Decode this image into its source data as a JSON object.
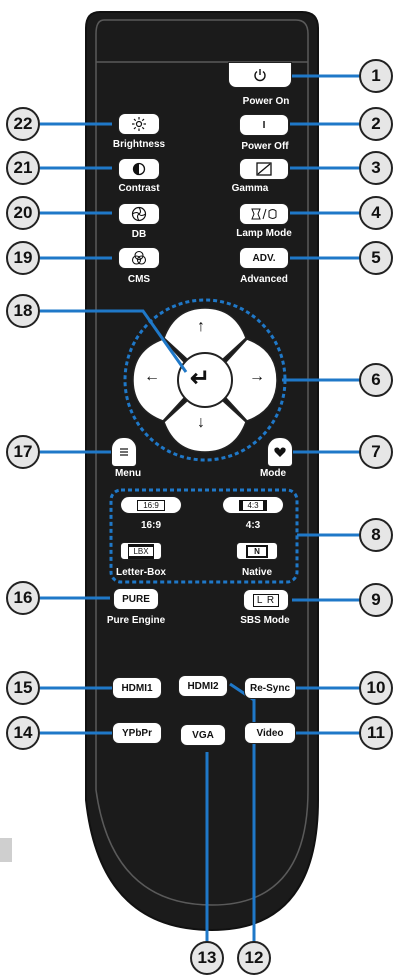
{
  "colors": {
    "remote_body": "#1b1b1b",
    "remote_edge": "#5a5a5a",
    "connector": "#1f78c8",
    "callout_fill": "#e6e6e6",
    "button": "#ffffff"
  },
  "buttons": {
    "power_on": {
      "label": "Power On",
      "icon": "power-icon"
    },
    "power_off": {
      "label": "Power Off",
      "glyph": "I"
    },
    "gamma": {
      "label": "Gamma",
      "icon": "gamma-icon"
    },
    "lamp_mode": {
      "label": "Lamp Mode",
      "icon": "lamp-mode-icon"
    },
    "advanced": {
      "label": "Advanced",
      "glyph": "ADV."
    },
    "brightness": {
      "label": "Brightness",
      "icon": "brightness-icon"
    },
    "contrast": {
      "label": "Contrast",
      "icon": "contrast-icon"
    },
    "db": {
      "label": "DB",
      "icon": "db-icon"
    },
    "cms": {
      "label": "CMS",
      "icon": "cms-icon"
    },
    "menu": {
      "label": "Menu",
      "icon": "menu-icon"
    },
    "mode": {
      "label": "Mode",
      "icon": "mode-icon"
    },
    "ratio_169": {
      "label": "16:9",
      "glyph": "16:9"
    },
    "ratio_43": {
      "label": "4:3",
      "glyph": "4:3"
    },
    "letterbox": {
      "label": "Letter-Box",
      "glyph": "LBX"
    },
    "native": {
      "label": "Native",
      "glyph": "N"
    },
    "pure": {
      "label": "Pure Engine",
      "glyph": "PURE"
    },
    "sbs": {
      "label": "SBS Mode",
      "glyph": "L R"
    },
    "hdmi1": {
      "glyph": "HDMI1"
    },
    "hdmi2": {
      "glyph": "HDMI2"
    },
    "resync": {
      "glyph": "Re-Sync"
    },
    "ypbpr": {
      "glyph": "YPbPr"
    },
    "vga": {
      "glyph": "VGA"
    },
    "video": {
      "glyph": "Video"
    }
  },
  "dpad": {
    "up": "↑",
    "down": "↓",
    "left": "←",
    "right": "→",
    "enter": "↵"
  },
  "callouts": [
    "1",
    "2",
    "3",
    "4",
    "5",
    "6",
    "7",
    "8",
    "9",
    "10",
    "11",
    "12",
    "13",
    "14",
    "15",
    "16",
    "17",
    "18",
    "19",
    "20",
    "21",
    "22"
  ]
}
